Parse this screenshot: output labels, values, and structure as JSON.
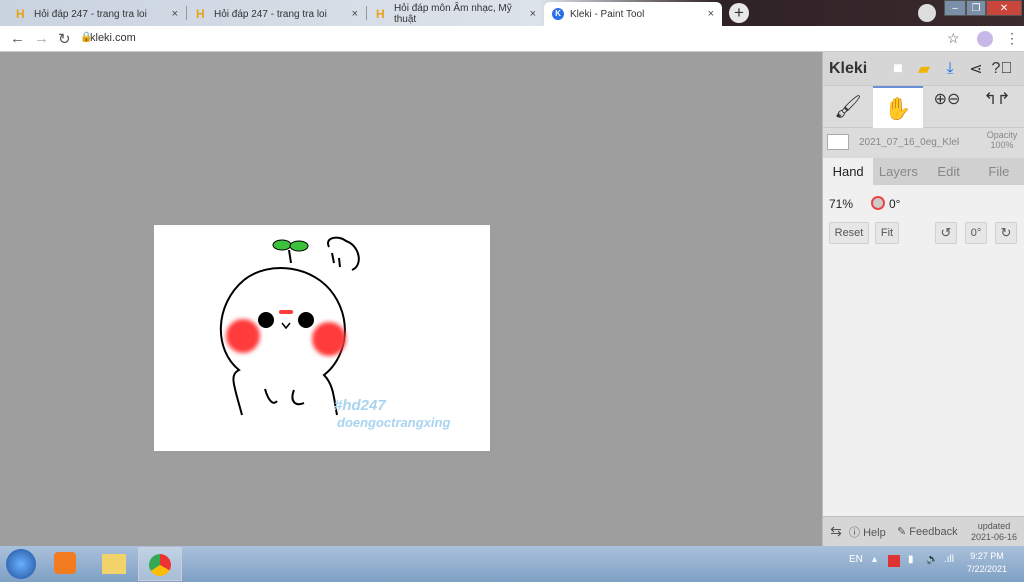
{
  "browser": {
    "tabs": [
      {
        "title": "Hỏi đáp 247 - trang tra loi",
        "favicon": "H"
      },
      {
        "title": "Hỏi đáp 247 - trang tra loi",
        "favicon": "H"
      },
      {
        "title": "Hỏi đáp môn Âm nhạc, Mỹ thuật",
        "favicon": "H"
      },
      {
        "title": "Kleki - Paint Tool",
        "favicon": "K",
        "active": true
      }
    ],
    "close_glyph": "×",
    "new_tab": "+",
    "url": "kleki.com"
  },
  "kleki": {
    "logo": "Kleki",
    "file_name": "2021_07_16_0eg_Kleki.png",
    "opacity_label": "Opacity",
    "opacity_value": "100%",
    "tabs": [
      "Hand",
      "Layers",
      "Edit",
      "File"
    ],
    "active_tab": "Hand",
    "zoom": "71%",
    "rotation": "0°",
    "buttons": {
      "reset": "Reset",
      "fit": "Fit",
      "rot_value": "0°"
    },
    "footer": {
      "help": "Help",
      "feedback": "Feedback",
      "updated": "updated",
      "date": "2021-06-16"
    }
  },
  "canvas": {
    "watermark_line1": "#hd247",
    "watermark_line2": "doengoctrangxing",
    "watermark_color": "#a8d4f0",
    "cheek_color": "#ff3b3b",
    "leaf_color": "#3cc13c"
  },
  "taskbar": {
    "lang": "EN",
    "time": "9:27 PM",
    "date": "7/22/2021"
  }
}
